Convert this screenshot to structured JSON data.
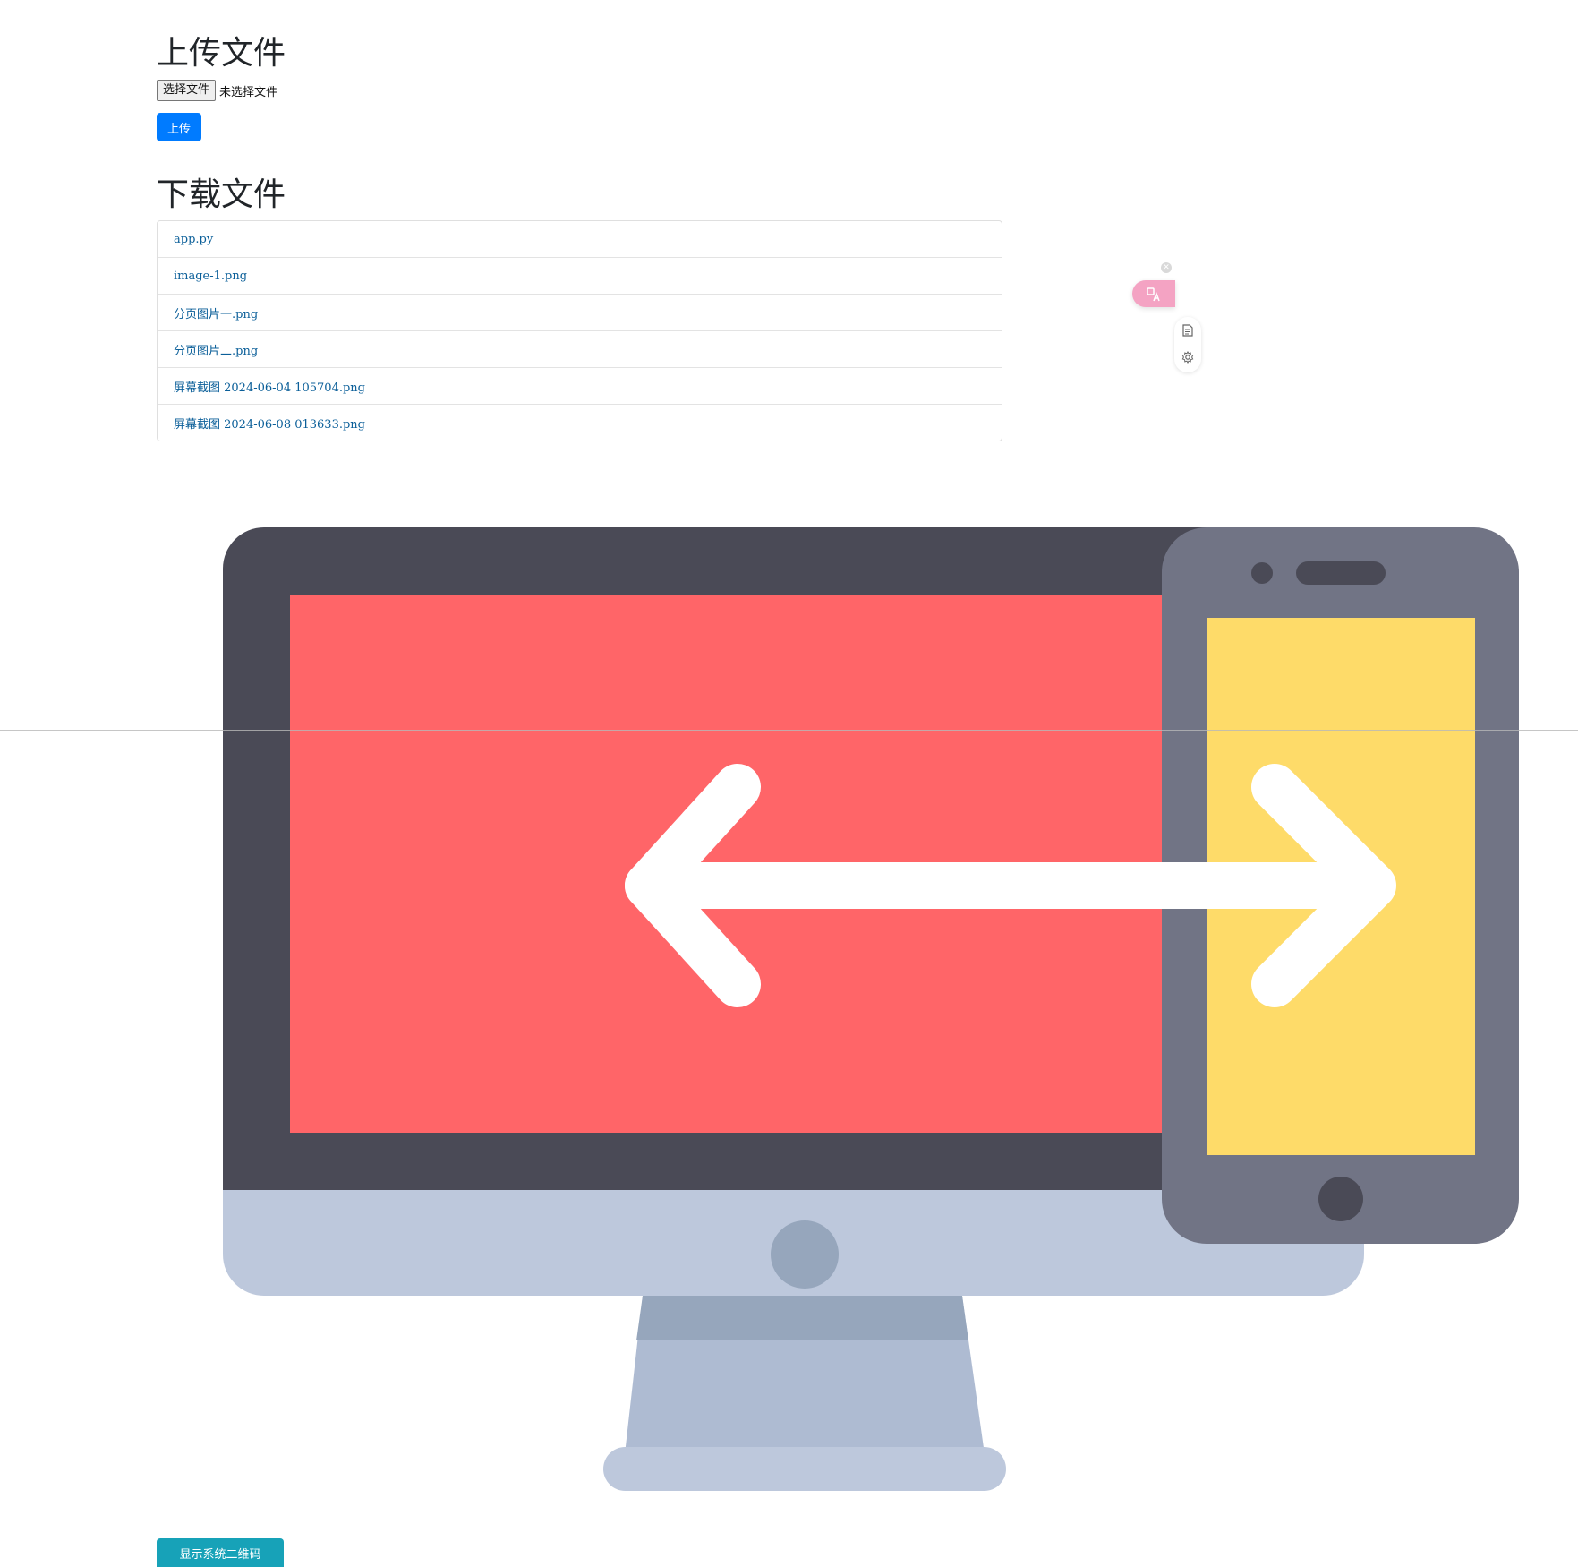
{
  "upload": {
    "title": "上传文件",
    "choose_button": "选择文件",
    "no_file_text": "未选择文件",
    "submit_label": "上传"
  },
  "download": {
    "title": "下载文件",
    "files": [
      "app.py",
      "image-1.png",
      "分页图片一.png",
      "分页图片二.png",
      "屏幕截图 2024-06-04 105704.png",
      "屏幕截图 2024-06-08 013633.png"
    ]
  },
  "widget": {
    "close_icon": "close-icon",
    "translate_icon": "translate-icon",
    "translate_color": "#f4a3c3",
    "tools": [
      "document-icon",
      "settings-icon"
    ]
  },
  "illustration": {
    "subject": "desktop-phone-sync-icon",
    "colors": {
      "monitor_frame": "#4a4a56",
      "monitor_screen": "#ff6568",
      "monitor_base": "#bdc8dc",
      "phone_frame": "#717485",
      "phone_screen": "#fedb69",
      "arrow": "#ffffff"
    }
  },
  "qr": {
    "button_label": "显示系统二维码"
  },
  "colors": {
    "primary": "#007bff",
    "info": "#17a2b8",
    "link": "#0b5f99"
  }
}
